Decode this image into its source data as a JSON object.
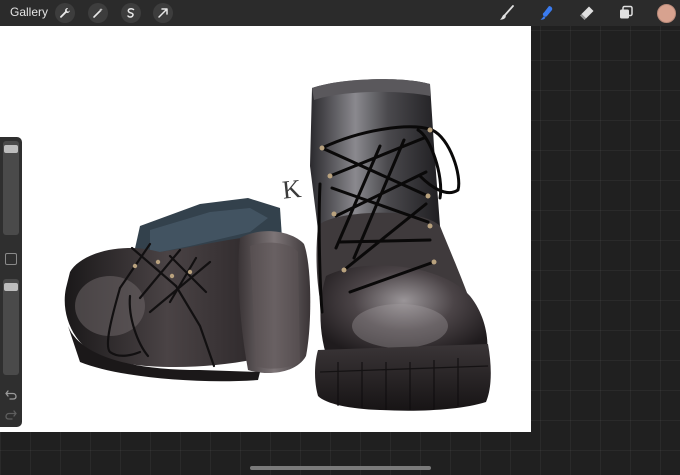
{
  "toolbar": {
    "gallery_label": "Gallery",
    "left_tools": [
      "wrench-icon",
      "magic-wand-icon",
      "selection-icon",
      "transform-arrow-icon"
    ],
    "right_tools": [
      "brush-icon",
      "smudge-icon",
      "eraser-icon",
      "layers-icon"
    ],
    "active_tool": "smudge-icon",
    "active_color": "#3a7bf0",
    "current_color": "#d7a28f"
  },
  "sidebar": {
    "brush_size_level": 0.05,
    "opacity_level": 0.05
  },
  "canvas": {
    "signature": "K"
  }
}
